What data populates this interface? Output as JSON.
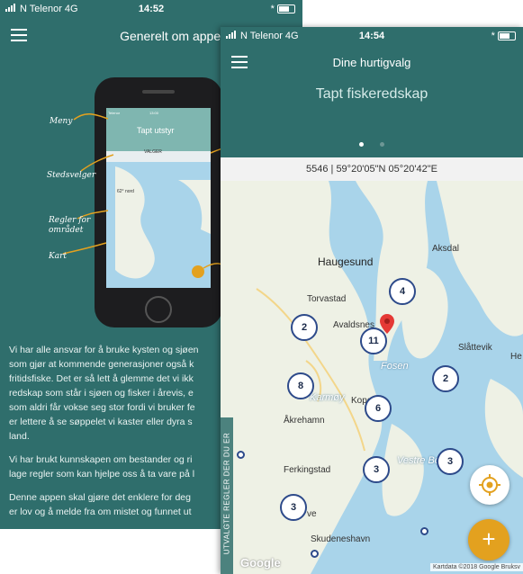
{
  "left_screen": {
    "status": {
      "carrier": "N Telenor  4G",
      "time": "14:52",
      "battery": "* "
    },
    "title": "Generelt om appen",
    "annotations": {
      "menu": "Meny",
      "area_picker": "Stedsvelger",
      "rules": "Regler for",
      "rules2": "området",
      "map": "Kart"
    },
    "phone_mockup": {
      "status": "Telenor",
      "time": "13:00",
      "title": "Tapt utstyr",
      "picker": "VALGER",
      "latlon": "62° nord"
    },
    "body": [
      "Vi har alle ansvar for å bruke kysten og sjøen",
      "som gjør at kommende generasjoner også k",
      "fritidsfiske. Det er så lett å glemme det vi ikk",
      "redskap som står i sjøen og fisker i årevis, e",
      "som aldri får vokse seg stor fordi vi bruker fe",
      "er lettere å se søppelet vi kaster eller dyra s",
      "land."
    ],
    "body2": [
      "Vi har brukt kunnskapen om bestander og ri",
      "lage regler som kan hjelpe oss å ta vare på l"
    ],
    "body3": [
      "Denne appen skal gjøre det enklere for deg",
      "er lov og å melde fra om mistet og funnet ut"
    ]
  },
  "right_screen": {
    "status": {
      "carrier": "N Telenor  4G",
      "time": "14:54",
      "battery": "* "
    },
    "title": "Dine hurtigvalg",
    "quick_title": "Tapt fiskeredskap",
    "coord_bar": "5546 | 59°20'05\"N 05°20'42\"E",
    "map_labels": {
      "aksdal": "Aksdal",
      "haugesund": "Haugesund",
      "torvastad": "Torvastad",
      "avaldsnes": "Avaldsnes",
      "slattevik": "Slåttevik",
      "he": "He",
      "fosen": "Fosen",
      "karmoy": "Karmøy",
      "kopervik": "Kopervik",
      "akrehamn": "Åkrehamn",
      "ferkingstad": "Ferkingstad",
      "vestre_bokn": "Vestre Bokn",
      "skudeneshavn": "Skudeneshavn",
      "ve": "ve"
    },
    "clusters": {
      "c1": "4",
      "c2": "2",
      "c3": "11",
      "c4": "8",
      "c5": "6",
      "c6": "2",
      "c7": "3",
      "c8": "3",
      "c9": "3"
    },
    "side_label": "UTVALGTE REGLER DER DU ER",
    "google": "Google",
    "attribution": "Kartdata ©2018 Google   Bruksv",
    "fab_add": "+"
  },
  "colors": {
    "teal": "#2f6e6c",
    "accent": "#e3a11f",
    "cluster_border": "#2d4a8a"
  }
}
